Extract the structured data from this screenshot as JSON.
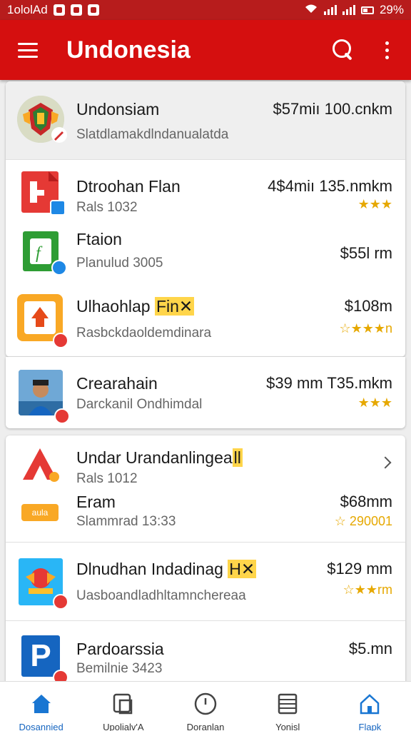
{
  "status_bar": {
    "left_text": "1ololАd",
    "battery": "29%"
  },
  "app_bar": {
    "title": "Undonesia"
  },
  "featured": {
    "name": "Undonsiam",
    "price": "$57miı 100.cnkm",
    "subtitle": "Slatdlamakdlndanualatda"
  },
  "card1": [
    {
      "name": "Dtroohan Flan",
      "price": "4$4miı 135.nmkm",
      "subtitle": "Rals 1032",
      "rating": "★★★"
    },
    {
      "name": "Ftaion",
      "price": "$55l rm",
      "subtitle": "Planulud 3005",
      "rating": ""
    },
    {
      "name": "Ulhaohlap",
      "name_highlight": "Fin✕",
      "price": "$108m",
      "subtitle": "Rasbckdaoldemdinara",
      "rating": "☆★★★n"
    }
  ],
  "card2": [
    {
      "name": "Crearahain",
      "price": "$39 mm T35.mkm",
      "subtitle": "Darckanil Ondhimdal",
      "rating": "★★★"
    }
  ],
  "card3": [
    {
      "name": "Undar Urandanlingea",
      "name_highlight": "ll",
      "price": "",
      "subtitle": "Rals 1012",
      "rating": ""
    },
    {
      "name": "Eram",
      "price": "$68mm",
      "subtitle": "Slammrad 13:33",
      "rating": "☆ 290001",
      "thumb_text": "aula"
    },
    {
      "name": "Dlnudhan Indadinag",
      "name_highlight": "H✕",
      "price": "$129 mm",
      "subtitle": "Uasboandladhltamnchereaa",
      "rating": "☆★★rm"
    },
    {
      "name": "Pardoarssia",
      "price": "$5.mn",
      "subtitle": "Bemilnie 3423",
      "rating": "",
      "thumb_text": "P"
    }
  ],
  "bottom_nav": [
    {
      "label": "Dosannied",
      "icon": "home-icon",
      "active": true
    },
    {
      "label": "Upolialv'A",
      "icon": "copy-icon",
      "active": false
    },
    {
      "label": "Doranlan",
      "icon": "clock-icon",
      "active": false
    },
    {
      "label": "Yonisl",
      "icon": "list-icon",
      "active": false
    },
    {
      "label": "Flapk",
      "icon": "home-outline-icon",
      "active": true
    }
  ],
  "colors": {
    "primary": "#d50f0f",
    "status_bar": "#b71c1c",
    "rating": "#e6a800",
    "active_nav": "#1565c0"
  }
}
